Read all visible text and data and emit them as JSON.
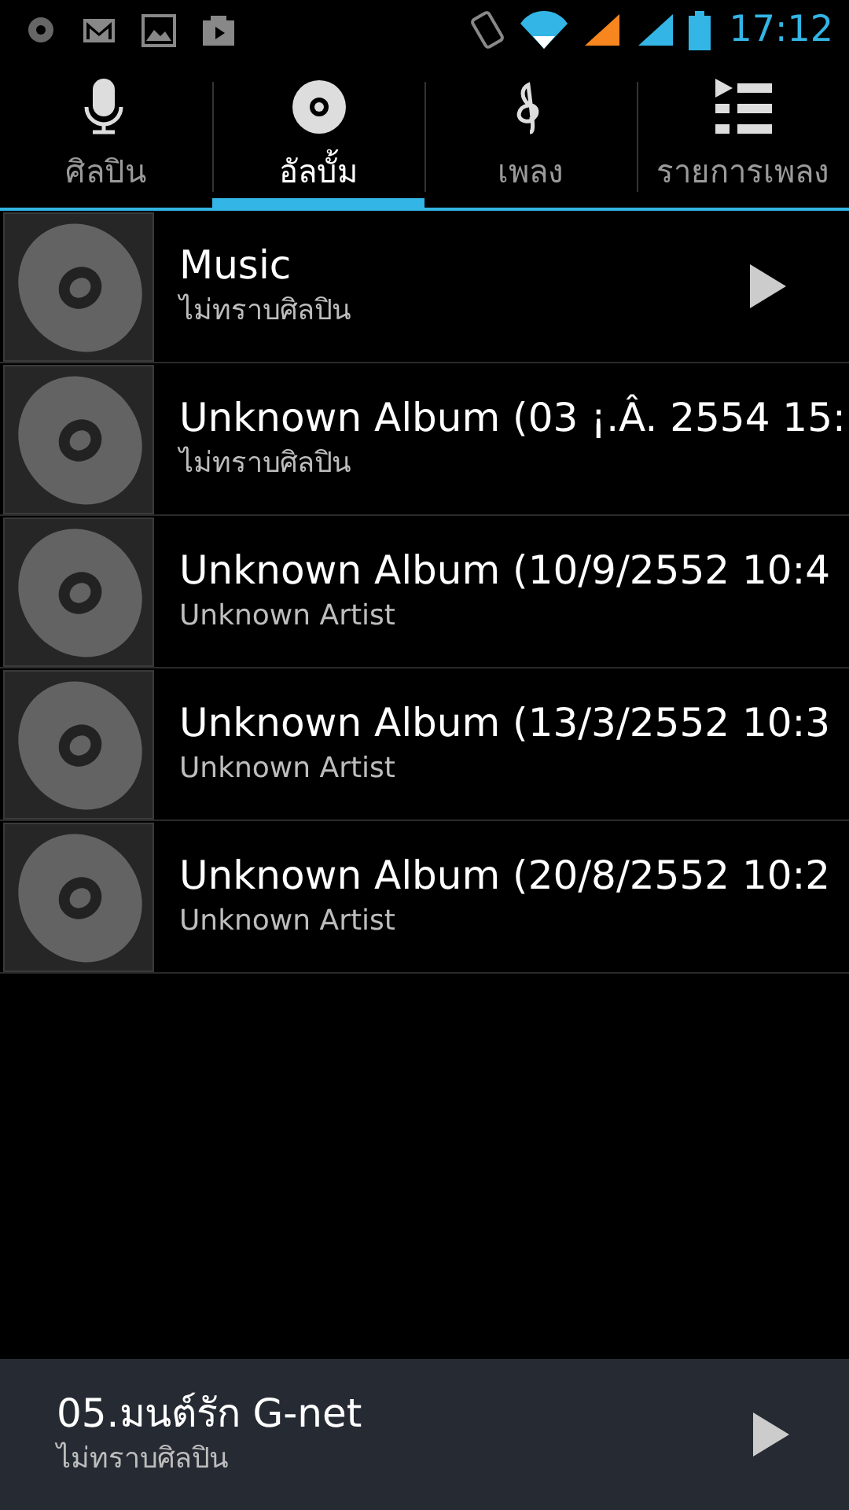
{
  "status_bar": {
    "time": "17:12"
  },
  "tabs": [
    {
      "label": "ศิลปิน",
      "selected": false
    },
    {
      "label": "อัลบั้ม",
      "selected": true
    },
    {
      "label": "เพลง",
      "selected": false
    },
    {
      "label": "รายการเพลง",
      "selected": false
    }
  ],
  "albums": [
    {
      "title": "Music",
      "artist": "ไม่ทราบศิลปิน",
      "playing": true
    },
    {
      "title": "Unknown Album (03 ¡.Â. 2554 15:",
      "artist": "ไม่ทราบศิลปิน",
      "playing": false
    },
    {
      "title": "Unknown Album (10/9/2552 10:4",
      "artist": "Unknown Artist",
      "playing": false
    },
    {
      "title": "Unknown Album (13/3/2552 10:3",
      "artist": "Unknown Artist",
      "playing": false
    },
    {
      "title": "Unknown Album (20/8/2552 10:2",
      "artist": "Unknown Artist",
      "playing": false
    }
  ],
  "now_playing": {
    "title": "05.มนต์รัก G-net",
    "artist": "ไม่ทราบศิลปิน"
  }
}
